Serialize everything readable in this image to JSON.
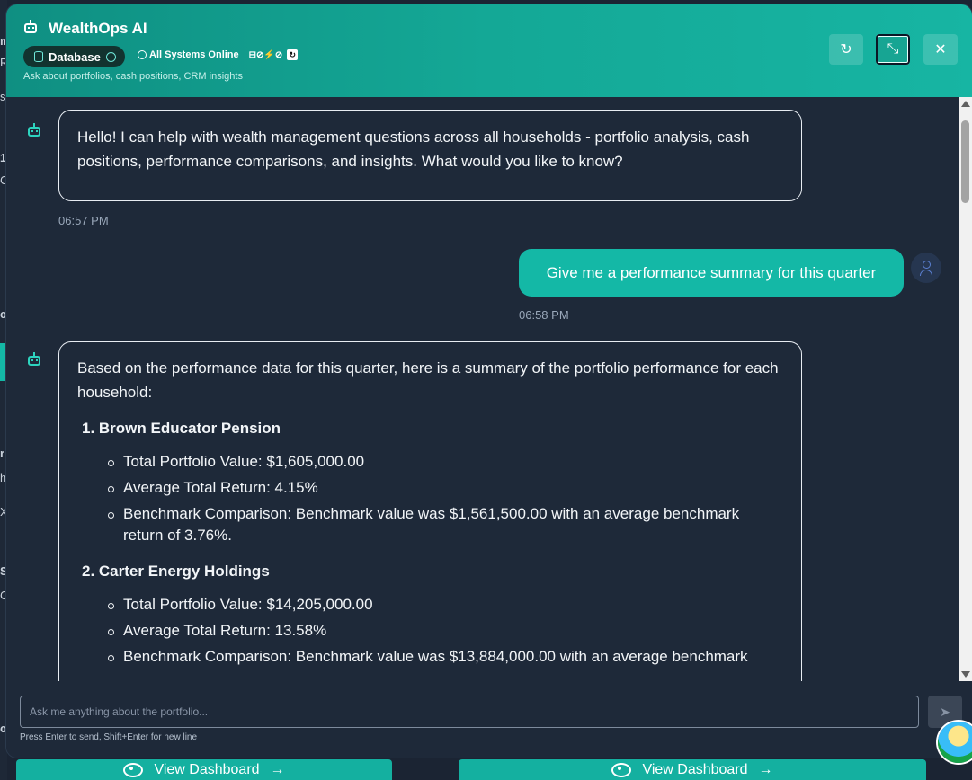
{
  "background": {
    "left_edge_chars": [
      "m",
      "R",
      "s",
      "1",
      "C",
      "o",
      "r",
      "h",
      "X",
      "S",
      "C",
      "o"
    ],
    "view_dashboard_label": "View Dashboard"
  },
  "header": {
    "title": "WealthOps AI",
    "db_label": "Database",
    "status_text": "All Systems Online",
    "subtitle": "Ask about portfolios, cash positions, CRM insights",
    "refresh_label": "↻",
    "minimize_label": "⤡",
    "close_label": "✕"
  },
  "messages": [
    {
      "role": "assistant",
      "text": "Hello! I can help with wealth management questions across all households - portfolio analysis, cash positions, performance comparisons, and insights. What would you like to know?",
      "time": "06:57 PM"
    },
    {
      "role": "user",
      "text": "Give me a performance summary for this quarter",
      "time": "06:58 PM"
    },
    {
      "role": "assistant",
      "intro": "Based on the performance data for this quarter, here is a summary of the portfolio performance for each household:",
      "households": [
        {
          "heading": "1. Brown Educator Pension",
          "items": [
            "Total Portfolio Value: $1,605,000.00",
            "Average Total Return: 4.15%",
            "Benchmark Comparison: Benchmark value was $1,561,500.00 with an average benchmark return of 3.76%."
          ]
        },
        {
          "heading": "2. Carter Energy Holdings",
          "items": [
            "Total Portfolio Value: $14,205,000.00",
            "Average Total Return: 13.58%",
            "Benchmark Comparison: Benchmark value was $13,884,000.00 with an average benchmark"
          ]
        }
      ]
    }
  ],
  "input": {
    "placeholder": "Ask me anything about the portfolio...",
    "hint": "Press Enter to send, Shift+Enter for new line"
  },
  "colors": {
    "accent": "#14b8a6",
    "panel_bg": "#1e2939"
  }
}
